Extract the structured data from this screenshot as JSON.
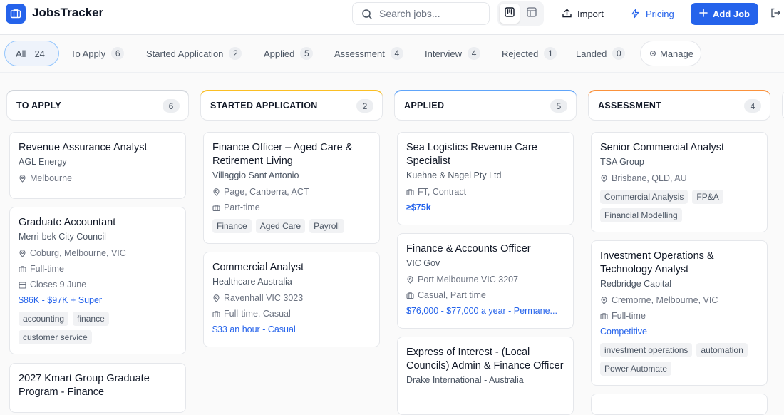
{
  "header": {
    "app_name": "JobsTracker",
    "search_placeholder": "Search jobs...",
    "import_label": "Import",
    "pricing_label": "Pricing",
    "add_job_label": "Add Job"
  },
  "filters": [
    {
      "label": "All",
      "count": "24"
    },
    {
      "label": "To Apply",
      "count": "6"
    },
    {
      "label": "Started Application",
      "count": "2"
    },
    {
      "label": "Applied",
      "count": "5"
    },
    {
      "label": "Assessment",
      "count": "4"
    },
    {
      "label": "Interview",
      "count": "4"
    },
    {
      "label": "Rejected",
      "count": "1"
    },
    {
      "label": "Landed",
      "count": "0"
    }
  ],
  "manage_label": "Manage",
  "columns": [
    {
      "title": "TO APPLY",
      "count": "6",
      "accent": "#d1d5db",
      "cards": [
        {
          "title": "Revenue Assurance Analyst",
          "company": "AGL Energy",
          "location": "Melbourne"
        },
        {
          "title": "Graduate Accountant",
          "company": "Merri-bek City Council",
          "location": "Coburg, Melbourne, VIC",
          "type": "Full-time",
          "closes": "Closes 9 June",
          "salary": "$86K - $97K + Super",
          "tags": [
            "accounting",
            "finance",
            "customer service"
          ]
        },
        {
          "title": "2027 Kmart Group Graduate Program - Finance"
        }
      ]
    },
    {
      "title": "STARTED APPLICATION",
      "count": "2",
      "accent": "#fbbf24",
      "cards": [
        {
          "title": "Finance Officer – Aged Care & Retirement Living",
          "company": "Villaggio Sant Antonio",
          "location": "Page, Canberra, ACT",
          "type": "Part-time",
          "tags": [
            "Finance",
            "Aged Care",
            "Payroll"
          ]
        },
        {
          "title": "Commercial Analyst",
          "company": "Healthcare Australia",
          "location": "Ravenhall VIC 3023",
          "type": "Full-time, Casual",
          "salary": "$33 an hour - Casual"
        }
      ]
    },
    {
      "title": "APPLIED",
      "count": "5",
      "accent": "#60a5fa",
      "cards": [
        {
          "title": "Sea Logistics Revenue Care Specialist",
          "company": "Kuehne & Nagel Pty Ltd",
          "type": "FT, Contract",
          "salary": "≥$75k"
        },
        {
          "title": "Finance & Accounts Officer",
          "company": "VIC Gov",
          "location": "Port Melbourne VIC 3207",
          "type": "Casual, Part time",
          "salary": "$76,000 - $77,000 a year - Permane..."
        },
        {
          "title": "Express of Interest - (Local Councils) Admin & Finance Officer",
          "company": "Drake International - Australia"
        }
      ]
    },
    {
      "title": "ASSESSMENT",
      "count": "4",
      "accent": "#fb923c",
      "cards": [
        {
          "title": "Senior Commercial Analyst",
          "company": "TSA Group",
          "location": "Brisbane, QLD, AU",
          "tags": [
            "Commercial Analysis",
            "FP&A",
            "Financial Modelling"
          ]
        },
        {
          "title": "Investment Operations & Technology Analyst",
          "company": "Redbridge Capital",
          "location": "Cremorne, Melbourne, VIC",
          "type": "Full-time",
          "salary": "Competitive",
          "tags": [
            "investment operations",
            "automation",
            "Power Automate"
          ]
        }
      ]
    }
  ]
}
